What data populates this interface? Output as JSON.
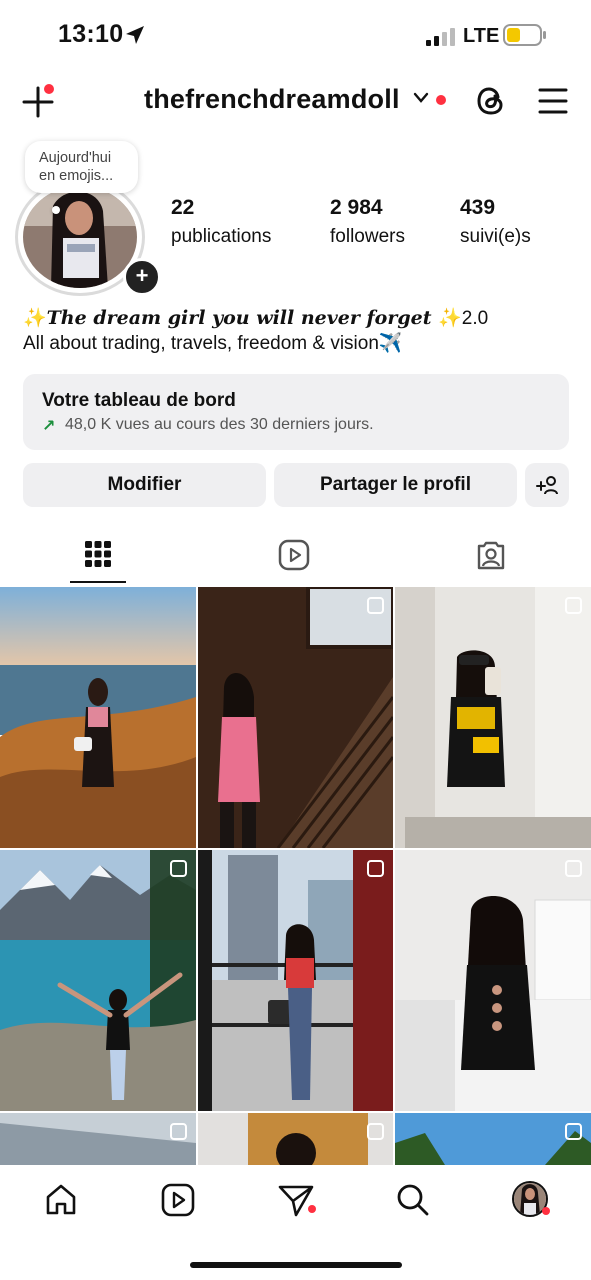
{
  "status_bar": {
    "time": "13:10",
    "network": "LTE"
  },
  "header": {
    "username": "thefrenchdreamdoll"
  },
  "profile": {
    "note": [
      "Aujourd'hui",
      "en emojis..."
    ],
    "stats": [
      {
        "value": "22",
        "label": "publications"
      },
      {
        "value": "2 984",
        "label": "followers"
      },
      {
        "value": "439",
        "label": "suivi(e)s"
      }
    ],
    "bio_line1_prefix": "✨",
    "bio_line1_text": "The dream girl you will never forget",
    "bio_line1_suffix": "✨2.0",
    "bio_line2": "All about trading, travels, freedom & vision✈️"
  },
  "dashboard": {
    "title": "Votre tableau de bord",
    "subtitle": "48,0 K vues au cours des 30 derniers jours."
  },
  "buttons": {
    "edit": "Modifier",
    "share": "Partager le profil"
  },
  "tabs": [
    "grid-icon",
    "reels-icon",
    "tagged-icon"
  ],
  "active_tab": "grid-icon",
  "bottom_nav": [
    "home-icon",
    "reels-icon",
    "direct-message-icon",
    "search-icon",
    "profile-avatar"
  ],
  "colors": {
    "notification": "#ff3040",
    "trend_up": "#1b8f3c",
    "button_bg": "#efeff1"
  }
}
